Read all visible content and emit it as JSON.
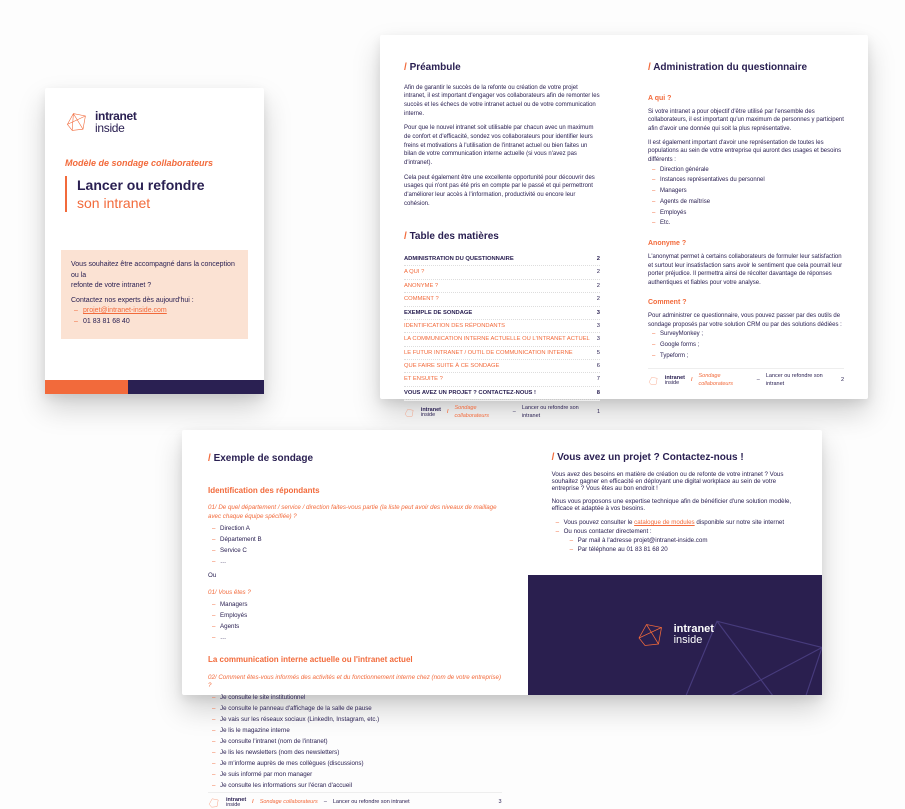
{
  "brand": {
    "name": "intranet",
    "sub": "inside"
  },
  "cover": {
    "kicker": "Modèle de sondage collaborateurs",
    "title1": "Lancer ou refondre",
    "title2": "son intranet",
    "contact_intro1": "Vous souhaitez être accompagné dans la conception ou la",
    "contact_intro2": "refonte de votre intranet ?",
    "contact_intro3": "Contactez nos experts dès aujourd'hui :",
    "contact_email": "projet@intranet-inside.com",
    "contact_phone": "01 83 81 68 40"
  },
  "preambule": {
    "heading": "Préambule",
    "p1": "Afin de garantir le succès de la refonte ou création de votre projet intranet, il est important d'engager vos collaborateurs afin de remonter les succès et les échecs de votre intranet actuel ou de votre communication interne.",
    "p2": "Pour que le nouvel intranet soit utilisable par chacun avec un maximum de confort et d'efficacité, sondez vos collaborateurs pour identifier leurs freins et motivations à l'utilisation de l'intranet actuel ou bien faites un bilan de votre communication interne actuelle (si vous n'avez pas d'intranet).",
    "p3": "Cela peut également être une excellente opportunité pour découvrir des usages qui n'ont pas été pris en compte par le passé et qui permettront d'améliorer leur accès à l'information, productivité ou encore leur cohésion."
  },
  "toc": {
    "heading": "Table des matières",
    "items": [
      {
        "label": "ADMINISTRATION DU QUESTIONNAIRE",
        "page": "2"
      },
      {
        "label": "A QUI ?",
        "page": "2"
      },
      {
        "label": "ANONYME ?",
        "page": "2"
      },
      {
        "label": "COMMENT ?",
        "page": "2"
      },
      {
        "label": "EXEMPLE DE SONDAGE",
        "page": "3"
      },
      {
        "label": "IDENTIFICATION DES RÉPONDANTS",
        "page": "3"
      },
      {
        "label": "LA COMMUNICATION INTERNE ACTUELLE OU L'INTRANET ACTUEL",
        "page": "3"
      },
      {
        "label": "LE FUTUR INTRANET / OUTIL DE COMMUNICATION INTERNE",
        "page": "5"
      },
      {
        "label": "QUE FAIRE SUITE À CE SONDAGE",
        "page": "6"
      },
      {
        "label": "ET ENSUITE ?",
        "page": "7"
      },
      {
        "label": "VOUS AVEZ UN PROJET ? CONTACTEZ-NOUS !",
        "page": "8"
      }
    ]
  },
  "admin": {
    "heading": "Administration du questionnaire",
    "q1": {
      "title": "A qui ?",
      "p1": "Si votre intranet a pour objectif d'être utilisé par l'ensemble des collaborateurs, il est important qu'un maximum de personnes y participent afin d'avoir une donnée qui soit la plus représentative.",
      "p2": "Il est également important d'avoir une représentation de toutes les populations au sein de votre entreprise qui auront des usages et besoins différents :",
      "list": [
        "Direction générale",
        "Instances représentatives du personnel",
        "Managers",
        "Agents de maîtrise",
        "Employés",
        "Etc."
      ]
    },
    "q2": {
      "title": "Anonyme ?",
      "p": "L'anonymat permet à certains collaborateurs de formuler leur satisfaction et surtout leur insatisfaction sans avoir le sentiment que cela pourrait leur porter préjudice. Il permettra ainsi de récolter davantage de réponses authentiques et fiables pour votre analyse."
    },
    "q3": {
      "title": "Comment ?",
      "p": "Pour administrer ce questionnaire, vous pouvez passer par des outils de sondage proposés par votre solution CRM ou par des solutions dédiées :",
      "list": [
        "SurveyMonkey ;",
        "Google forms ;",
        "Typeform ;"
      ]
    }
  },
  "example": {
    "heading": "Exemple de sondage",
    "sec1_title": "Identification des répondants",
    "q1": "01/ De quel département / service / direction faites-vous partie (la liste peut avoir des niveaux de maillage avec chaque équipe spécifiée) ?",
    "q1_list": [
      "Direction A",
      "Département B",
      "Service C",
      "…"
    ],
    "or": "Ou",
    "q2": "01/ Vous êtes ?",
    "q2_list": [
      "Managers",
      "Employés",
      "Agents",
      "…"
    ],
    "sec2_title": "La communication interne actuelle ou l'intranet actuel",
    "q3": "02/ Comment êtes-vous informés des activités et du fonctionnement interne chez (nom de votre entreprise) ?",
    "q3_list": [
      "Je consulte le site institutionnel",
      "Je consulte le panneau d'affichage de la salle de pause",
      "Je vais sur les réseaux sociaux (LinkedIn, Instagram, etc.)",
      "Je lis le magazine interne",
      "Je consulte l'intranet (nom de l'intranet)",
      "Je lis les newsletters (nom des newsletters)",
      "Je m'informe auprès de mes collègues (discussions)",
      "Je suis informé par mon manager",
      "Je consulte les informations sur l'écran d'accueil"
    ]
  },
  "cta": {
    "heading": "Vous avez un projet ? Contactez-nous !",
    "p1": "Vous avez des besoins en matière de création ou de refonte de votre intranet ? Vous souhaitez gagner en efficacité en déployant une digital workplace au sein de votre entreprise ? Vous êtes au bon endroit !",
    "p2": "Nous vous proposons une expertise technique afin de bénéficier d'une solution modèle, efficace et adaptée à vos besoins.",
    "b1a": "Vous pouvez consulter le ",
    "b1link": "catalogue de modules",
    "b1b": " disponible sur notre site internet",
    "b2": "Ou nous contacter directement :",
    "b3": "Par mail à l'adresse projet@intranet-inside.com",
    "b4": "Par téléphone au 01 83 81 68 20"
  },
  "footer": {
    "crumb": "Sondage collaborateurs",
    "doc": "Lancer ou refondre son intranet",
    "page1": "1",
    "page2": "2",
    "page3": "3"
  }
}
